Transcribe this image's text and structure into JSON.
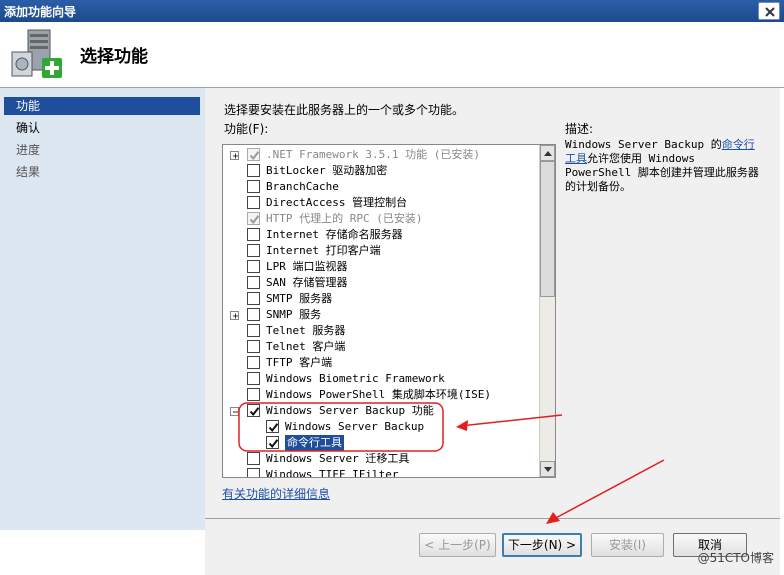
{
  "window": {
    "title": "添加功能向导"
  },
  "header": {
    "title": "选择功能"
  },
  "nav": [
    {
      "label": "功能",
      "state": "active"
    },
    {
      "label": "确认",
      "state": "normal"
    },
    {
      "label": "进度",
      "state": "disabled"
    },
    {
      "label": "结果",
      "state": "disabled"
    }
  ],
  "main": {
    "instruction": "选择要安装在此服务器上的一个或多个功能。",
    "features_label": "功能(F):",
    "features": [
      {
        "label": ".NET Framework 3.5.1 功能  (已安装)",
        "checked": true,
        "disabled": true,
        "expander": true,
        "indent": 0
      },
      {
        "label": "BitLocker 驱动器加密",
        "checked": false,
        "disabled": false,
        "expander": false,
        "indent": 0
      },
      {
        "label": "BranchCache",
        "checked": false,
        "disabled": false,
        "expander": false,
        "indent": 0
      },
      {
        "label": "DirectAccess 管理控制台",
        "checked": false,
        "disabled": false,
        "expander": false,
        "indent": 0
      },
      {
        "label": "HTTP 代理上的 RPC  (已安装)",
        "checked": true,
        "disabled": true,
        "expander": false,
        "indent": 0
      },
      {
        "label": "Internet 存储命名服务器",
        "checked": false,
        "disabled": false,
        "expander": false,
        "indent": 0
      },
      {
        "label": "Internet 打印客户端",
        "checked": false,
        "disabled": false,
        "expander": false,
        "indent": 0
      },
      {
        "label": "LPR 端口监视器",
        "checked": false,
        "disabled": false,
        "expander": false,
        "indent": 0
      },
      {
        "label": "SAN 存储管理器",
        "checked": false,
        "disabled": false,
        "expander": false,
        "indent": 0
      },
      {
        "label": "SMTP 服务器",
        "checked": false,
        "disabled": false,
        "expander": false,
        "indent": 0
      },
      {
        "label": "SNMP 服务",
        "checked": false,
        "disabled": false,
        "expander": true,
        "indent": 0
      },
      {
        "label": "Telnet 服务器",
        "checked": false,
        "disabled": false,
        "expander": false,
        "indent": 0
      },
      {
        "label": "Telnet 客户端",
        "checked": false,
        "disabled": false,
        "expander": false,
        "indent": 0
      },
      {
        "label": "TFTP 客户端",
        "checked": false,
        "disabled": false,
        "expander": false,
        "indent": 0
      },
      {
        "label": "Windows Biometric Framework",
        "checked": false,
        "disabled": false,
        "expander": false,
        "indent": 0
      },
      {
        "label": "Windows PowerShell 集成脚本环境(ISE)",
        "checked": false,
        "disabled": false,
        "expander": false,
        "indent": 0
      },
      {
        "label": "Windows Server Backup 功能",
        "checked": true,
        "disabled": false,
        "expander": true,
        "expanded": true,
        "indent": 0
      },
      {
        "label": "Windows Server Backup",
        "checked": true,
        "disabled": false,
        "expander": false,
        "indent": 1
      },
      {
        "label": "命令行工具",
        "checked": true,
        "disabled": false,
        "expander": false,
        "indent": 1,
        "selected": true
      },
      {
        "label": "Windows Server 迁移工具",
        "checked": false,
        "disabled": false,
        "expander": false,
        "indent": 0
      },
      {
        "label": "Windows TIFF IFilter",
        "checked": false,
        "disabled": false,
        "expander": false,
        "indent": 0
      }
    ],
    "description_label": "描述:",
    "description": {
      "part1": "Windows Server Backup 的",
      "link": "命令行工具",
      "part2": "允许您使用 Windows PowerShell 脚本创建并管理此服务器的计划备份。"
    },
    "more_info_link": "有关功能的详细信息"
  },
  "buttons": {
    "prev": "< 上一步(P)",
    "next": "下一步(N) >",
    "install": "安装(I)",
    "cancel": "取消"
  },
  "watermark": "@51CTO博客",
  "colors": {
    "accent": "#1f4e9c",
    "annotation": "#e02020",
    "nav_bg": "#dde7f2"
  }
}
